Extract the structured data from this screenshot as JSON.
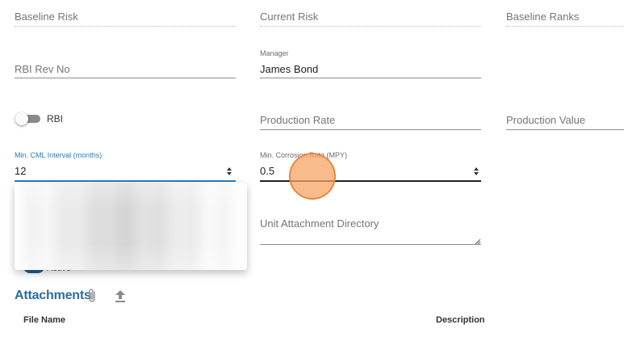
{
  "fields": {
    "baseline_risk": {
      "placeholder": "Baseline Risk"
    },
    "current_risk": {
      "placeholder": "Current Risk"
    },
    "baseline_ranks": {
      "placeholder": "Baseline Ranks"
    },
    "rbi_rev_no": {
      "placeholder": "RBI Rev No"
    },
    "manager": {
      "label": "Manager",
      "value": "James Bond"
    },
    "production_rate": {
      "placeholder": "Production Rate"
    },
    "production_value": {
      "placeholder": "Production Value"
    },
    "min_cml_interval": {
      "label": "Min. CML Interval (months)",
      "value": "12"
    },
    "min_corrosion_rate": {
      "label": "Min. Corrosion Rate (MPY)",
      "value": "0.5"
    },
    "unit_attachment_directory": {
      "placeholder": "Unit Attachment Directory"
    }
  },
  "toggles": {
    "rbi": {
      "label": "RBI",
      "on": false
    },
    "active": {
      "label": "Active",
      "on": true
    }
  },
  "attachments": {
    "title": "Attachments",
    "columns": {
      "file_name": "File Name",
      "description": "Description"
    }
  },
  "icons": {
    "attach": "paperclip-icon",
    "upload": "upload-icon"
  },
  "colors": {
    "accent": "#2b7bb9",
    "title": "#2b6e9d",
    "cursor": "#f8a464"
  }
}
